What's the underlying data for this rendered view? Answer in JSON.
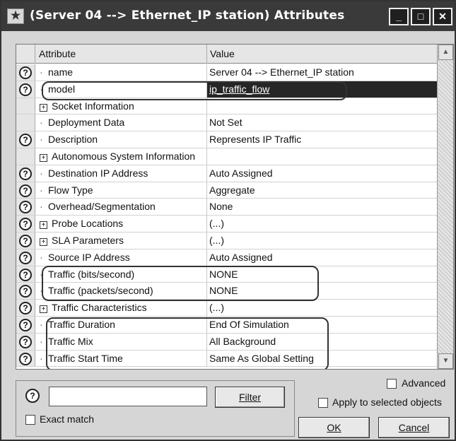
{
  "window": {
    "title": "(Server 04 --> Ethernet_IP station) Attributes",
    "system_icon": "★",
    "minimize_glyph": "_",
    "maximize_glyph": "□",
    "close_glyph": "✕"
  },
  "grid": {
    "col_attribute": "Attribute",
    "col_value": "Value",
    "help_glyph": "?",
    "expand_glyph": "+",
    "rows": [
      {
        "help": true,
        "expand": false,
        "attribute": "name",
        "value": "Server 04 --> Ethernet_IP station"
      },
      {
        "help": true,
        "expand": false,
        "attribute": "model",
        "value": "ip_traffic_flow",
        "selected": true
      },
      {
        "help": false,
        "expand": true,
        "attribute": "Socket Information",
        "value": ""
      },
      {
        "help": false,
        "expand": false,
        "attribute": "Deployment Data",
        "value": "Not Set"
      },
      {
        "help": true,
        "expand": false,
        "attribute": "Description",
        "value": "Represents IP Traffic"
      },
      {
        "help": false,
        "expand": true,
        "attribute": "Autonomous System Information",
        "value": ""
      },
      {
        "help": true,
        "expand": false,
        "attribute": "Destination IP Address",
        "value": "Auto Assigned"
      },
      {
        "help": true,
        "expand": false,
        "attribute": "Flow Type",
        "value": "Aggregate"
      },
      {
        "help": true,
        "expand": false,
        "attribute": "Overhead/Segmentation",
        "value": "None"
      },
      {
        "help": true,
        "expand": true,
        "attribute": "Probe Locations",
        "value": "(...)"
      },
      {
        "help": true,
        "expand": true,
        "attribute": "SLA Parameters",
        "value": "(...)"
      },
      {
        "help": true,
        "expand": false,
        "attribute": "Source IP Address",
        "value": "Auto Assigned"
      },
      {
        "help": true,
        "expand": false,
        "attribute": "Traffic (bits/second)",
        "value": "NONE"
      },
      {
        "help": true,
        "expand": false,
        "attribute": "Traffic (packets/second)",
        "value": "NONE"
      },
      {
        "help": true,
        "expand": true,
        "attribute": "Traffic Characteristics",
        "value": "(...)"
      },
      {
        "help": true,
        "expand": false,
        "attribute": "Traffic Duration",
        "value": "End Of Simulation"
      },
      {
        "help": true,
        "expand": false,
        "attribute": "Traffic Mix",
        "value": "All Background"
      },
      {
        "help": true,
        "expand": false,
        "attribute": "Traffic Start Time",
        "value": "Same As Global Setting"
      }
    ]
  },
  "filter": {
    "input_value": "",
    "button_label": "Filter",
    "exact_match_label": "Exact match",
    "exact_match_checked": false
  },
  "options": {
    "advanced_label": "Advanced",
    "advanced_checked": false,
    "apply_selected_label": "Apply to selected objects",
    "apply_selected_checked": false
  },
  "buttons": {
    "ok_label": "OK",
    "cancel_label": "Cancel"
  }
}
